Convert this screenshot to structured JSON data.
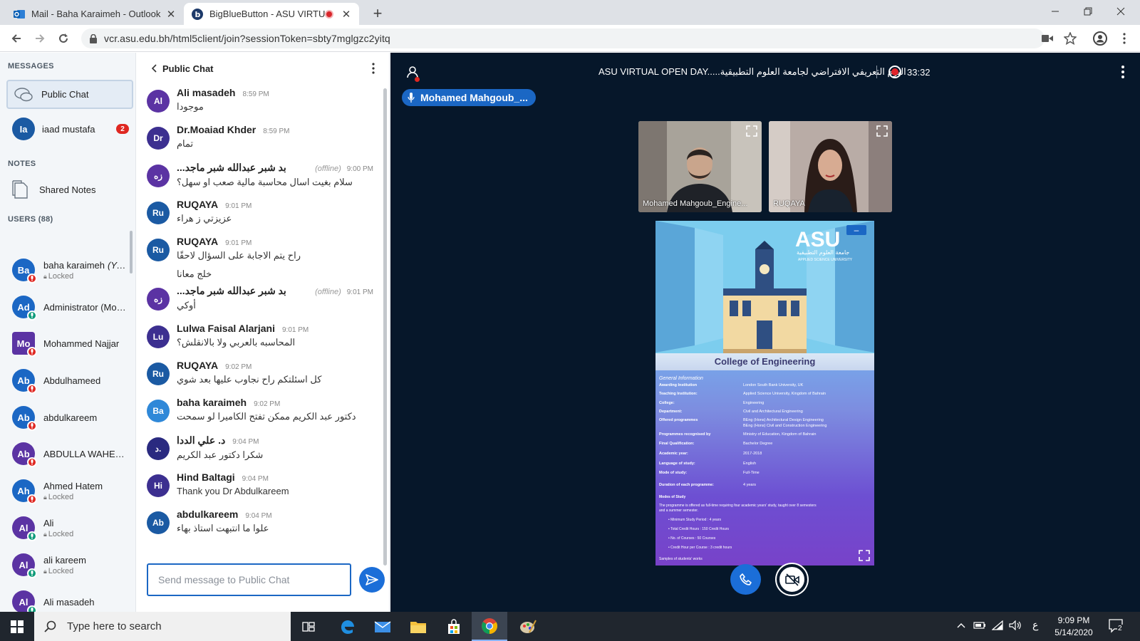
{
  "browser": {
    "tabs": [
      {
        "title": "Mail - Baha Karaimeh - Outlook",
        "active": false
      },
      {
        "title": "BigBlueButton - ASU VIRTUA",
        "active": true
      }
    ],
    "url": "vcr.asu.edu.bh/html5client/join?sessionToken=sbty7mglgzc2yitq"
  },
  "sidebar": {
    "messages_title": "MESSAGES",
    "public_chat_label": "Public Chat",
    "private_chats": [
      {
        "initials": "Ia",
        "name": "iaad mustafa",
        "unread": "2"
      }
    ],
    "notes_title": "NOTES",
    "shared_notes_label": "Shared Notes",
    "users_title": "USERS (88)",
    "users": [
      {
        "initials": "Ba",
        "name": "baha karaimeh",
        "you": "(You)",
        "status": "Locked",
        "mic": "muted",
        "color": "#1b67c4"
      },
      {
        "initials": "Ad",
        "name": "Administrator (Moa...",
        "status": "",
        "mic": "on",
        "color": "#1b67c4"
      },
      {
        "initials": "Mo",
        "name": "Mohammed Najjar",
        "status": "",
        "mic": "muted",
        "color": "#5b33a3"
      },
      {
        "initials": "Ab",
        "name": "Abdulhameed",
        "status": "",
        "mic": "muted",
        "color": "#1b67c4"
      },
      {
        "initials": "Ab",
        "name": "abdulkareem",
        "status": "",
        "mic": "muted",
        "color": "#1b67c4"
      },
      {
        "initials": "Ab",
        "name": "ABDULLA WAHEEB ...",
        "status": "",
        "mic": "muted",
        "color": "#5b33a3"
      },
      {
        "initials": "Ah",
        "name": "Ahmed Hatem",
        "status": "Locked",
        "mic": "muted",
        "color": "#1b67c4"
      },
      {
        "initials": "Al",
        "name": "Ali",
        "status": "Locked",
        "mic": "on",
        "color": "#5b33a3"
      },
      {
        "initials": "Al",
        "name": "ali kareem",
        "status": "Locked",
        "mic": "on",
        "color": "#5b33a3"
      },
      {
        "initials": "Al",
        "name": "Ali masadeh",
        "status": "",
        "mic": "on",
        "color": "#5b33a3"
      }
    ]
  },
  "chat": {
    "title": "Public Chat",
    "input_placeholder": "Send message to Public Chat",
    "messages": [
      {
        "initials": "Al",
        "color": "#5b33a3",
        "sender": "Ali masadeh",
        "time": "8:59 PM",
        "offline": "",
        "lines": [
          "موجودا"
        ]
      },
      {
        "initials": "Dr",
        "color": "#3c2f90",
        "sender": "Dr.Moaiad Khder",
        "time": "8:59 PM",
        "offline": "",
        "lines": [
          "تمام"
        ]
      },
      {
        "initials": "زه",
        "color": "#5b33a3",
        "sender": "...بد شبر عبدالله شبر ماجد",
        "time": "9:00 PM",
        "offline": "(offline)",
        "lines": [
          "سلام بغيت اسال محاسبة مالية صعب او سهل؟"
        ]
      },
      {
        "initials": "Ru",
        "color": "#1b5aa3",
        "sender": "RUQAYA",
        "time": "9:01 PM",
        "offline": "",
        "lines": [
          "عزيزتي ز هراء"
        ]
      },
      {
        "initials": "Ru",
        "color": "#1b5aa3",
        "sender": "RUQAYA",
        "time": "9:01 PM",
        "offline": "",
        "lines": [
          "راح يتم الاجابة على السؤال لاحقًا",
          "خلج معانا"
        ]
      },
      {
        "initials": "زه",
        "color": "#5b33a3",
        "sender": "...بد شبر عبدالله شبر ماجد",
        "time": "9:01 PM",
        "offline": "(offline)",
        "lines": [
          "أوكي"
        ]
      },
      {
        "initials": "Lu",
        "color": "#3c2f90",
        "sender": "Lulwa Faisal Alarjani",
        "time": "9:01 PM",
        "offline": "",
        "lines": [
          "المحاسبه بالعربي ولا بالانقلش؟"
        ]
      },
      {
        "initials": "Ru",
        "color": "#1b5aa3",
        "sender": "RUQAYA",
        "time": "9:02 PM",
        "offline": "",
        "lines": [
          "كل اسئلتكم راح نجاوب عليها بعد شوي"
        ]
      },
      {
        "initials": "Ba",
        "color": "#2f88d8",
        "sender": "baha karaimeh",
        "time": "9:02 PM",
        "offline": "",
        "lines": [
          "دكتور عبد الكريم ممكن تفتح الكاميرا لو سمحت"
        ]
      },
      {
        "initials": "د.",
        "color": "#2a2a80",
        "sender": "د. علي الددا",
        "time": "9:04 PM",
        "offline": "",
        "lines": [
          "شكرا دكتور عبد الكريم"
        ]
      },
      {
        "initials": "Hi",
        "color": "#3c2f90",
        "sender": "Hind Baltagi",
        "time": "9:04 PM",
        "offline": "",
        "lines": [
          "Thank you Dr Abdulkareem"
        ]
      },
      {
        "initials": "Ab",
        "color": "#1b5aa3",
        "sender": "abdulkareem",
        "time": "9:04 PM",
        "offline": "",
        "lines": [
          "علوا ما انتبهت استاذ بهاء"
        ]
      }
    ]
  },
  "meeting": {
    "title": "ASU VIRTUAL OPEN DAY.....اليوم التعريفي الافتراضي لجامعة العلوم التطبيقية",
    "recording_time": "33:32",
    "talker": "Mohamed Mahgoub_...",
    "videos": [
      {
        "label": "Mohamed Mahgoub_Engine..."
      },
      {
        "label": "RUQAYA"
      }
    ]
  },
  "slide": {
    "logo": "ASU",
    "logo_arabic": "جامعة العلوم التطبيقية",
    "logo_sub": "APPLIED SCIENCE UNIVERSITY",
    "college": "College of Engineering",
    "info_heading": "General Information",
    "rows": [
      {
        "k": "Awarding Institution",
        "v": "London South Bank University, UK"
      },
      {
        "k": "Teaching Institution:",
        "v": "Applied Science University, Kingdom of Bahrain"
      },
      {
        "k": "College:",
        "v": "Engineering"
      },
      {
        "k": "Department:",
        "v": "Civil and Architectural Engineering"
      },
      {
        "k": "Offered programmes",
        "v": "BEng (Hons) Architectural Design Engineering"
      },
      {
        "k": "",
        "v": "BEng (Hons) Civil and Construction Engineering"
      },
      {
        "k": "Programmes recognised by",
        "v": "Ministry of Education, Kingdom of Bahrain"
      },
      {
        "k": "Final Qualification:",
        "v": "Bachelor Degree"
      },
      {
        "k": "Academic year:",
        "v": "2017-2018"
      },
      {
        "k": "Language of study:",
        "v": "English"
      },
      {
        "k": "Mode of study:",
        "v": "Full-Time"
      },
      {
        "k": "Duration of each programme:",
        "v": "4 years"
      }
    ],
    "modes_title": "Modes of Study",
    "modes_text": "The programme is offered as full-time requiring four academic years' study, taught over 8 semesters",
    "modes_text2": "and a summer semester.",
    "bullets": [
      "Minimum Study Period : 4 years",
      "Total Credit Hours : 150 Credit Hours",
      "No. of Courses : 50 Courses",
      "Credit Hour per Course : 3 credit hours"
    ],
    "footer": "Samples of students' works"
  },
  "taskbar": {
    "search_placeholder": "Type here to search",
    "time": "9:09 PM",
    "date": "5/14/2020",
    "lang": "ع",
    "notif_count": "2"
  },
  "colors": {
    "accent": "#1b6ed8",
    "main_bg": "#06172a",
    "muted": "#df2721",
    "mic_on": "#0f9b7a"
  }
}
